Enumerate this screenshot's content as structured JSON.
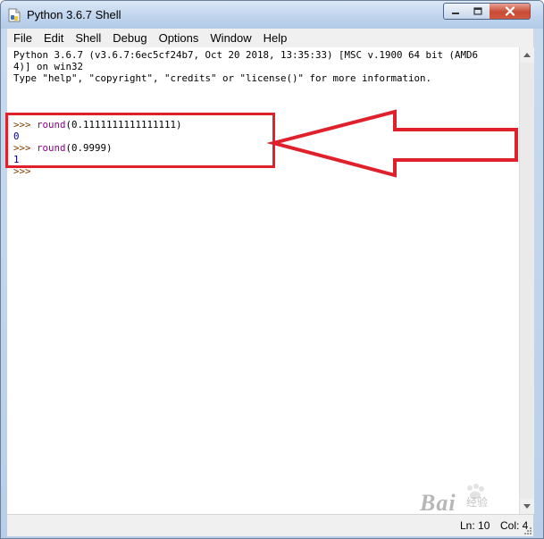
{
  "window": {
    "title": "Python 3.6.7 Shell"
  },
  "menu": {
    "items": [
      "File",
      "Edit",
      "Shell",
      "Debug",
      "Options",
      "Window",
      "Help"
    ]
  },
  "shell": {
    "banner_line1": "Python 3.6.7 (v3.6.7:6ec5cf24b7, Oct 20 2018, 13:35:33) [MSC v.1900 64 bit (AMD6",
    "banner_line2": "4)] on win32",
    "banner_line3": "Type \"help\", \"copyright\", \"credits\" or \"license()\" for more information.",
    "prompt": ">>> ",
    "cmd1_func": "round",
    "cmd1_args": "(0.1111111111111111)",
    "out1": "0",
    "cmd2_func": "round",
    "cmd2_args": "(0.9999)",
    "out2": "1",
    "prompt3": ">>> "
  },
  "status": {
    "ln": "Ln: 10",
    "col": "Col: 4"
  },
  "watermark": {
    "text": "Bai",
    "sub": "经验"
  },
  "colors": {
    "annotation": "#e0202a",
    "prompt": "#804000",
    "builtin": "#900090",
    "output": "#000080"
  },
  "icons": {
    "app": "python-idle-icon",
    "minimize": "minimize-icon",
    "maximize": "maximize-icon",
    "close": "close-icon"
  }
}
